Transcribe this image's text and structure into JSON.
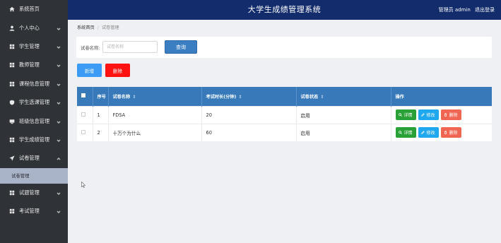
{
  "header": {
    "title": "大学生成绩管理系统",
    "user_label": "管理员 admin",
    "logout": "退出登录",
    "bg_color": "#132c6b"
  },
  "sidebar": {
    "items": [
      {
        "label": "系统首页",
        "icon": "home-icon"
      },
      {
        "label": "个人中心",
        "icon": "user-icon",
        "chevron": "down"
      },
      {
        "label": "学生管理",
        "icon": "grid-icon",
        "chevron": "down"
      },
      {
        "label": "教师管理",
        "icon": "grid-icon",
        "chevron": "down"
      },
      {
        "label": "课程信息管理",
        "icon": "grid-icon",
        "chevron": "down"
      },
      {
        "label": "学生选课管理",
        "icon": "shield-icon",
        "chevron": "down"
      },
      {
        "label": "班级信息管理",
        "icon": "monitor-icon",
        "chevron": "down"
      },
      {
        "label": "学生成绩管理",
        "icon": "grid-icon",
        "chevron": "down"
      },
      {
        "label": "试卷管理",
        "icon": "send-icon",
        "chevron": "up"
      },
      {
        "label": "试题管理",
        "icon": "grid-icon",
        "chevron": "down"
      },
      {
        "label": "考试管理",
        "icon": "grid-icon",
        "chevron": "down"
      }
    ],
    "active_sub": "试卷管理"
  },
  "breadcrumb": {
    "home": "系统首页",
    "current": "试卷管理"
  },
  "search": {
    "label": "试卷名称:",
    "placeholder": "试卷名称",
    "value": "",
    "button": "查询"
  },
  "actions": {
    "add": "新增",
    "delete": "删除"
  },
  "table": {
    "columns": [
      "序号",
      "试卷名称",
      "考试时长(分钟)",
      "试卷状态",
      "操作"
    ],
    "rows": [
      {
        "index": "1",
        "name": "FDSA",
        "duration": "20",
        "status": "启用"
      },
      {
        "index": "2",
        "name": "十万个为什么",
        "duration": "60",
        "status": "启用"
      }
    ],
    "row_actions": {
      "detail": "详情",
      "edit": "修改",
      "remove": "删除"
    },
    "header_color": "#3779b9"
  }
}
